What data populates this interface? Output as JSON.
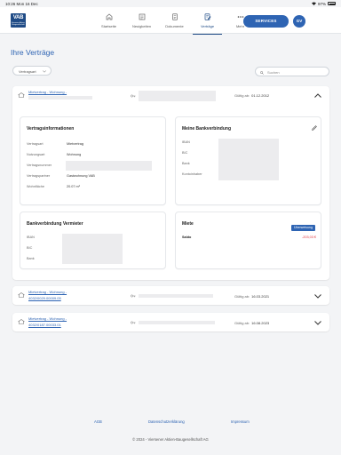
{
  "status_bar": {
    "time": "10:26",
    "date": "Mon 16 Dec",
    "battery": "97%"
  },
  "header": {
    "logo_main": "VAB",
    "logo_sub": "Viersener Aktien-Baugesellschaft",
    "nav": [
      {
        "label": "Startseite",
        "icon": "home-icon"
      },
      {
        "label": "Neuigkeiten",
        "icon": "news-icon"
      },
      {
        "label": "Dokumente",
        "icon": "document-icon"
      },
      {
        "label": "Verträge",
        "icon": "contract-icon",
        "active": true
      },
      {
        "label": "Mehr",
        "icon": "more-icon"
      }
    ],
    "services_label": "SERVICES",
    "avatar_initials": "GV"
  },
  "page": {
    "title": "Ihre Verträge"
  },
  "filter": {
    "selected": "Vertragsart"
  },
  "search": {
    "placeholder": "Suchen"
  },
  "contracts": [
    {
      "line1": "Mietvertrag - Wohnung -",
      "line2": "",
      "valid_label": "Gültig ab:",
      "valid_date": "01.12.2012",
      "expanded": true
    },
    {
      "line1": "Mietvertrag - Wohnung -",
      "line2": "4032/0029.00009.05",
      "valid_label": "Gültig ab:",
      "valid_date": "16.03.2021",
      "expanded": false
    },
    {
      "line1": "Mietvertrag - Wohnung -",
      "line2": "4032/0187.00033.01",
      "valid_label": "Gültig ab:",
      "valid_date": "16.08.2023",
      "expanded": false
    }
  ],
  "contract_info": {
    "title": "Vertragsinformationen",
    "rows": [
      {
        "key": "Vertragsart",
        "value": "Mietvertrag"
      },
      {
        "key": "Nutzungsart",
        "value": "Wohnung"
      },
      {
        "key": "Vertragsnummer",
        "value": ""
      },
      {
        "key": "Vertragspartner",
        "value": "Gastwohnung VAB"
      },
      {
        "key": "Wohnfläche",
        "value": "20.07 m²"
      }
    ]
  },
  "my_bank": {
    "title": "Meine Bankverbindung",
    "rows": [
      {
        "key": "IBAN"
      },
      {
        "key": "BIC"
      },
      {
        "key": "Bank"
      },
      {
        "key": "Kontoinhaber"
      }
    ]
  },
  "landlord_bank": {
    "title": "Bankverbindung Vermieter",
    "rows": [
      {
        "key": "IBAN"
      },
      {
        "key": "BIC"
      },
      {
        "key": "Bank"
      }
    ]
  },
  "rent": {
    "title": "Miete",
    "badge": "Überweisung",
    "saldo_label": "Saldo",
    "saldo_value": "-203,03 €"
  },
  "footer": {
    "links": [
      "AGB",
      "Datenschutzerklärung",
      "Impressum"
    ],
    "copyright": "© 2024 - Viersener Aktien-Baugesellschaft AG"
  },
  "colors": {
    "brand": "#2e64b3",
    "logo": "#1f4b86",
    "negative": "#e0303a"
  }
}
